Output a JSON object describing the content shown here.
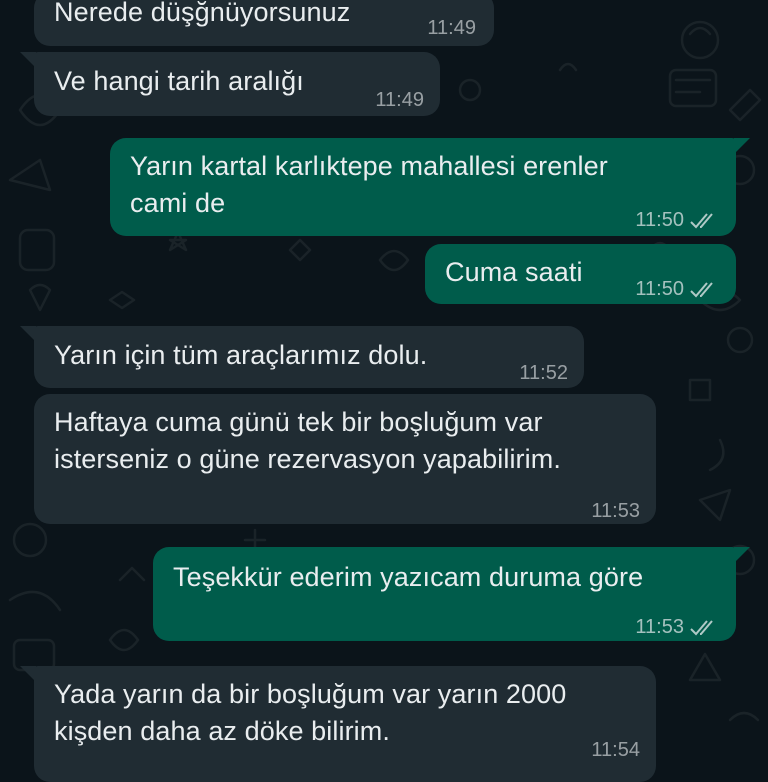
{
  "messages": [
    {
      "direction": "in",
      "text": "Nerede düşğnüyorsunuz",
      "time": "11:49"
    },
    {
      "direction": "in",
      "text": "Ve hangi tarih aralığı",
      "time": "11:49"
    },
    {
      "direction": "out",
      "text": "Yarın kartal karlıktepe mahallesi erenler\ncami de",
      "time": "11:50",
      "status": "read-check-icon"
    },
    {
      "direction": "out",
      "text": "Cuma saati",
      "time": "11:50",
      "status": "read-check-icon"
    },
    {
      "direction": "in",
      "text": "Yarın için tüm araçlarımız dolu.",
      "time": "11:52"
    },
    {
      "direction": "in",
      "text": "Haftaya cuma günü tek bir boşluğum var\nisterseniz o güne rezervasyon yapabilirim.",
      "time": "11:53"
    },
    {
      "direction": "out",
      "text": "Teşekkür ederim yazıcam duruma göre",
      "time": "11:53",
      "status": "read-check-icon"
    },
    {
      "direction": "in",
      "text": "Yada yarın da bir boşluğum var yarın 2000\nkişden daha az döke bilirim.",
      "time": "11:54"
    }
  ],
  "colors": {
    "background": "#0b141a",
    "incoming_bubble": "#202c33",
    "outgoing_bubble": "#005c4b",
    "text": "#e9edef",
    "meta_text": "#8696a0"
  }
}
